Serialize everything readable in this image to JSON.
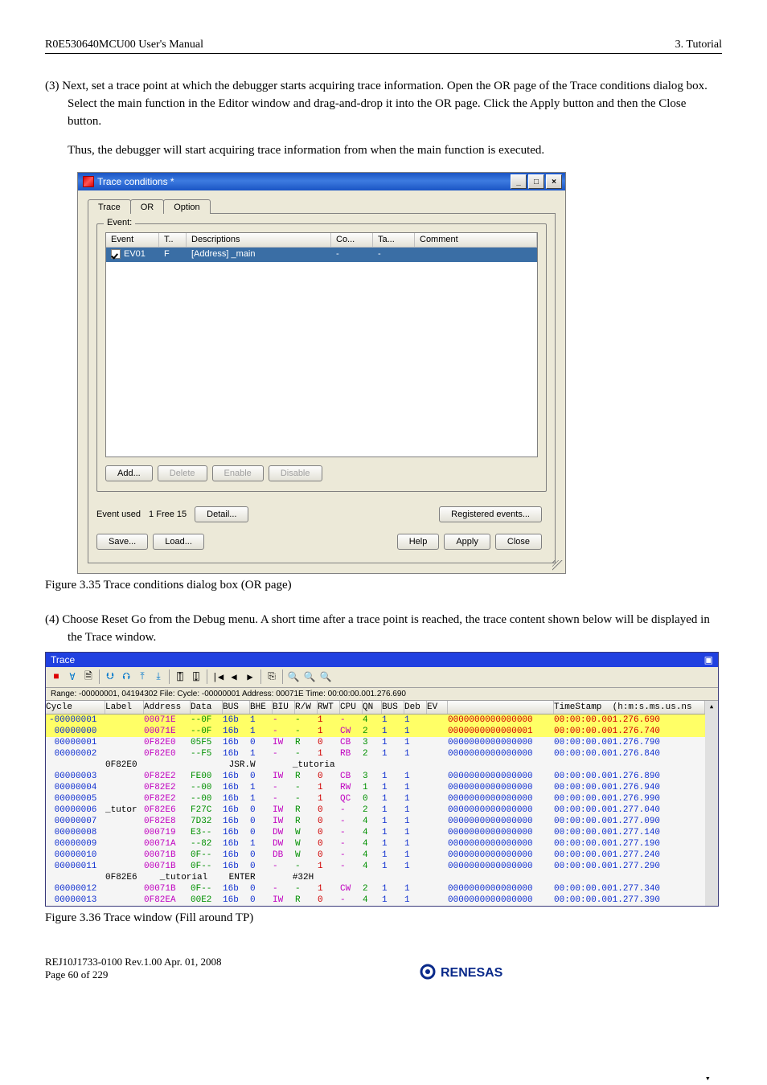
{
  "header": {
    "left": "R0E530640MCU00 User's Manual",
    "right": "3. Tutorial"
  },
  "para3": {
    "lead": "(3) Next, set a trace point at which the debugger starts acquiring trace information. Open the OR page of the Trace conditions dialog box. Select the main function in the Editor window and drag-and-drop it into the OR page. Click the Apply button and then the Close button.",
    "tail": "Thus, the debugger will start acquiring trace information from when the main function is executed."
  },
  "dialog": {
    "title": "Trace conditions *",
    "tabs": [
      "Trace",
      "OR",
      "Option"
    ],
    "active_tab_index": 1,
    "group_legend": "Event:",
    "columns": [
      "Event",
      "T..",
      "Descriptions",
      "Co...",
      "Ta...",
      "Comment"
    ],
    "row": {
      "event": "EV01",
      "t": "F",
      "desc": "[Address] _main",
      "co": "-",
      "ta": "-",
      "comment": ""
    },
    "btns_row1": [
      "Add...",
      "Delete",
      "Enable",
      "Disable"
    ],
    "event_used_label": "Event used",
    "event_used_value": "1  Free 15",
    "detail_btn": "Detail...",
    "registered_btn": "Registered events...",
    "save_btn": "Save...",
    "load_btn": "Load...",
    "help_btn": "Help",
    "apply_btn": "Apply",
    "close_btn": "Close"
  },
  "fig35": "Figure 3.35 Trace conditions dialog box (OR page)",
  "para4": "(4) Choose Reset Go from the Debug menu. A short time after a trace point is reached, the trace content shown below will be displayed in the Trace window.",
  "tracewin": {
    "title": "Trace",
    "range": "Range: -00000001, 04194302  File:   Cycle: -00000001  Address: 00071E  Time: 00:00:00.001.276.690",
    "head": [
      "Cycle",
      "Label",
      "Address",
      "Data",
      "BUS",
      "BHE",
      "BIU",
      "R/W",
      "RWT",
      "CPU",
      "QN",
      "BUS",
      "Deb",
      "EV",
      "",
      "TimeStamp  (h:m:s.ms.us.ns"
    ],
    "rows": [
      {
        "hl": true,
        "cycle": "-00000001",
        "label": "",
        "addr": "00071E",
        "data": "--0F",
        "bus": "16b",
        "bhe": "1",
        "biu": "-",
        "rw": "-",
        "rwt": "1",
        "cpu": "-",
        "qn": "4",
        "bus2": "1",
        "deb": "1",
        "ev": "",
        "zeros": "0000000000000000",
        "ts": "00:00:00.001.276.690"
      },
      {
        "hl": true,
        "cycle": " 00000000",
        "label": "",
        "addr": "00071E",
        "data": "--0F",
        "bus": "16b",
        "bhe": "1",
        "biu": "-",
        "rw": "-",
        "rwt": "1",
        "cpu": "CW",
        "qn": "2",
        "bus2": "1",
        "deb": "1",
        "ev": "",
        "zeros": "0000000000000001",
        "ts": "00:00:00.001.276.740"
      },
      {
        "cycle": " 00000001",
        "label": "",
        "addr": "0F82E0",
        "data": "05F5",
        "bus": "16b",
        "bhe": "0",
        "biu": "IW",
        "rw": "R",
        "rwt": "0",
        "cpu": "CB",
        "qn": "3",
        "bus2": "1",
        "deb": "1",
        "ev": "",
        "zeros": "0000000000000000",
        "ts": "00:00:00.001.276.790"
      },
      {
        "cycle": " 00000002",
        "label": "",
        "addr": "0F82E0",
        "data": "--F5",
        "bus": "16b",
        "bhe": "1",
        "biu": "-",
        "rw": "-",
        "rwt": "1",
        "cpu": "RB",
        "qn": "2",
        "bus2": "1",
        "deb": "1",
        "ev": "",
        "zeros": "0000000000000000",
        "ts": "00:00:00.001.276.840"
      },
      {
        "labelrow": true,
        "label": "0F82E0",
        "text": "                JSR.W       _tutoria"
      },
      {
        "cycle": " 00000003",
        "label": "",
        "addr": "0F82E2",
        "data": "FE00",
        "bus": "16b",
        "bhe": "0",
        "biu": "IW",
        "rw": "R",
        "rwt": "0",
        "cpu": "CB",
        "qn": "3",
        "bus2": "1",
        "deb": "1",
        "ev": "",
        "zeros": "0000000000000000",
        "ts": "00:00:00.001.276.890"
      },
      {
        "cycle": " 00000004",
        "label": "",
        "addr": "0F82E2",
        "data": "--00",
        "bus": "16b",
        "bhe": "1",
        "biu": "-",
        "rw": "-",
        "rwt": "1",
        "cpu": "RW",
        "qn": "1",
        "bus2": "1",
        "deb": "1",
        "ev": "",
        "zeros": "0000000000000000",
        "ts": "00:00:00.001.276.940"
      },
      {
        "cycle": " 00000005",
        "label": "",
        "addr": "0F82E2",
        "data": "--00",
        "bus": "16b",
        "bhe": "1",
        "biu": "-",
        "rw": "-",
        "rwt": "1",
        "cpu": "QC",
        "qn": "0",
        "bus2": "1",
        "deb": "1",
        "ev": "",
        "zeros": "0000000000000000",
        "ts": "00:00:00.001.276.990"
      },
      {
        "cycle": " 00000006",
        "label": "_tutor",
        "addr": "0F82E6",
        "data": "F27C",
        "bus": "16b",
        "bhe": "0",
        "biu": "IW",
        "rw": "R",
        "rwt": "0",
        "cpu": "-",
        "qn": "2",
        "bus2": "1",
        "deb": "1",
        "ev": "",
        "zeros": "0000000000000000",
        "ts": "00:00:00.001.277.040"
      },
      {
        "cycle": " 00000007",
        "label": "",
        "addr": "0F82E8",
        "data": "7D32",
        "bus": "16b",
        "bhe": "0",
        "biu": "IW",
        "rw": "R",
        "rwt": "0",
        "cpu": "-",
        "qn": "4",
        "bus2": "1",
        "deb": "1",
        "ev": "",
        "zeros": "0000000000000000",
        "ts": "00:00:00.001.277.090"
      },
      {
        "cycle": " 00000008",
        "label": "",
        "addr": "000719",
        "data": "E3--",
        "bus": "16b",
        "bhe": "0",
        "biu": "DW",
        "rw": "W",
        "rwt": "0",
        "cpu": "-",
        "qn": "4",
        "bus2": "1",
        "deb": "1",
        "ev": "",
        "zeros": "0000000000000000",
        "ts": "00:00:00.001.277.140"
      },
      {
        "cycle": " 00000009",
        "label": "",
        "addr": "00071A",
        "data": "--82",
        "bus": "16b",
        "bhe": "1",
        "biu": "DW",
        "rw": "W",
        "rwt": "0",
        "cpu": "-",
        "qn": "4",
        "bus2": "1",
        "deb": "1",
        "ev": "",
        "zeros": "0000000000000000",
        "ts": "00:00:00.001.277.190"
      },
      {
        "cycle": " 00000010",
        "label": "",
        "addr": "00071B",
        "data": "0F--",
        "bus": "16b",
        "bhe": "0",
        "biu": "DB",
        "rw": "W",
        "rwt": "0",
        "cpu": "-",
        "qn": "4",
        "bus2": "1",
        "deb": "1",
        "ev": "",
        "zeros": "0000000000000000",
        "ts": "00:00:00.001.277.240"
      },
      {
        "cycle": " 00000011",
        "label": "",
        "addr": "00071B",
        "data": "0F--",
        "bus": "16b",
        "bhe": "0",
        "biu": "-",
        "rw": "-",
        "rwt": "1",
        "cpu": "-",
        "qn": "4",
        "bus2": "1",
        "deb": "1",
        "ev": "",
        "zeros": "0000000000000000",
        "ts": "00:00:00.001.277.290"
      },
      {
        "labelrow": true,
        "label": "0F82E6",
        "text": "   _tutorial    ENTER       #32H"
      },
      {
        "cycle": " 00000012",
        "label": "",
        "addr": "00071B",
        "data": "0F--",
        "bus": "16b",
        "bhe": "0",
        "biu": "-",
        "rw": "-",
        "rwt": "1",
        "cpu": "CW",
        "qn": "2",
        "bus2": "1",
        "deb": "1",
        "ev": "",
        "zeros": "0000000000000000",
        "ts": "00:00:00.001.277.340"
      },
      {
        "cycle": " 00000013",
        "label": "",
        "addr": "0F82EA",
        "data": "00E2",
        "bus": "16b",
        "bhe": "0",
        "biu": "IW",
        "rw": "R",
        "rwt": "0",
        "cpu": "-",
        "qn": "4",
        "bus2": "1",
        "deb": "1",
        "ev": "",
        "zeros": "0000000000000000",
        "ts": "00:00:00.001.277.390"
      }
    ]
  },
  "fig36": "Figure 3.36 Trace window (Fill around TP)",
  "footer": {
    "line1": "REJ10J1733-0100   Rev.1.00    Apr. 01, 2008",
    "line2": "Page 60 of 229",
    "brand": "RENESAS"
  }
}
